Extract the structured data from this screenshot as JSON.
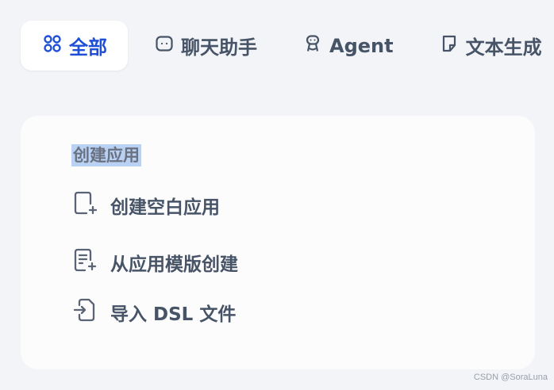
{
  "tabs": [
    {
      "label": "全部",
      "icon": "grid-circles-icon",
      "active": true
    },
    {
      "label": "聊天助手",
      "icon": "chat-bubble-icon",
      "active": false
    },
    {
      "label": "Agent",
      "icon": "robot-icon",
      "active": false
    },
    {
      "label": "文本生成",
      "icon": "note-icon",
      "active": false
    }
  ],
  "create_card": {
    "title": "创建应用",
    "items": [
      {
        "label": "创建空白应用",
        "icon": "file-plus-icon"
      },
      {
        "label": "从应用模版创建",
        "icon": "template-file-icon"
      },
      {
        "label": "导入 DSL 文件",
        "icon": "file-import-icon"
      }
    ]
  },
  "watermark": "CSDN @SoraLuna",
  "colors": {
    "background": "#f2f4f7",
    "active_tab_text": "#1f4fd6",
    "text": "#475467",
    "card_bg": "#fcfcfd",
    "title_highlight": "#b9d1f2"
  }
}
